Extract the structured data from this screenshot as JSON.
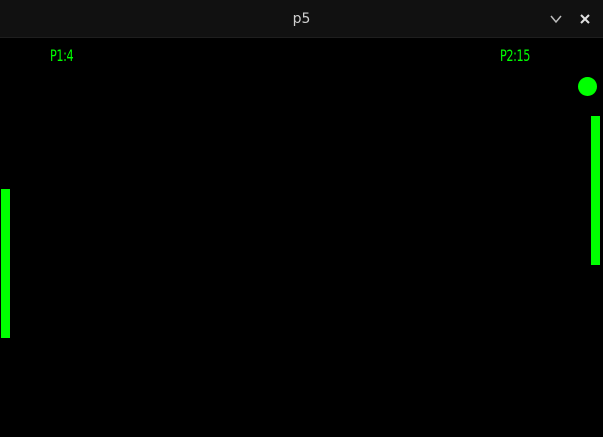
{
  "window": {
    "title": "p5",
    "controls": {
      "minimize_icon": "chevron-down-icon",
      "close_icon": "close-icon"
    }
  },
  "game": {
    "score_p1_text": "P1:4",
    "score_p2_text": "P2:15",
    "score_p1": 4,
    "score_p2": 15,
    "colors": {
      "background": "#000000",
      "foreground": "#00ff00",
      "titlebar": "#111111"
    }
  }
}
